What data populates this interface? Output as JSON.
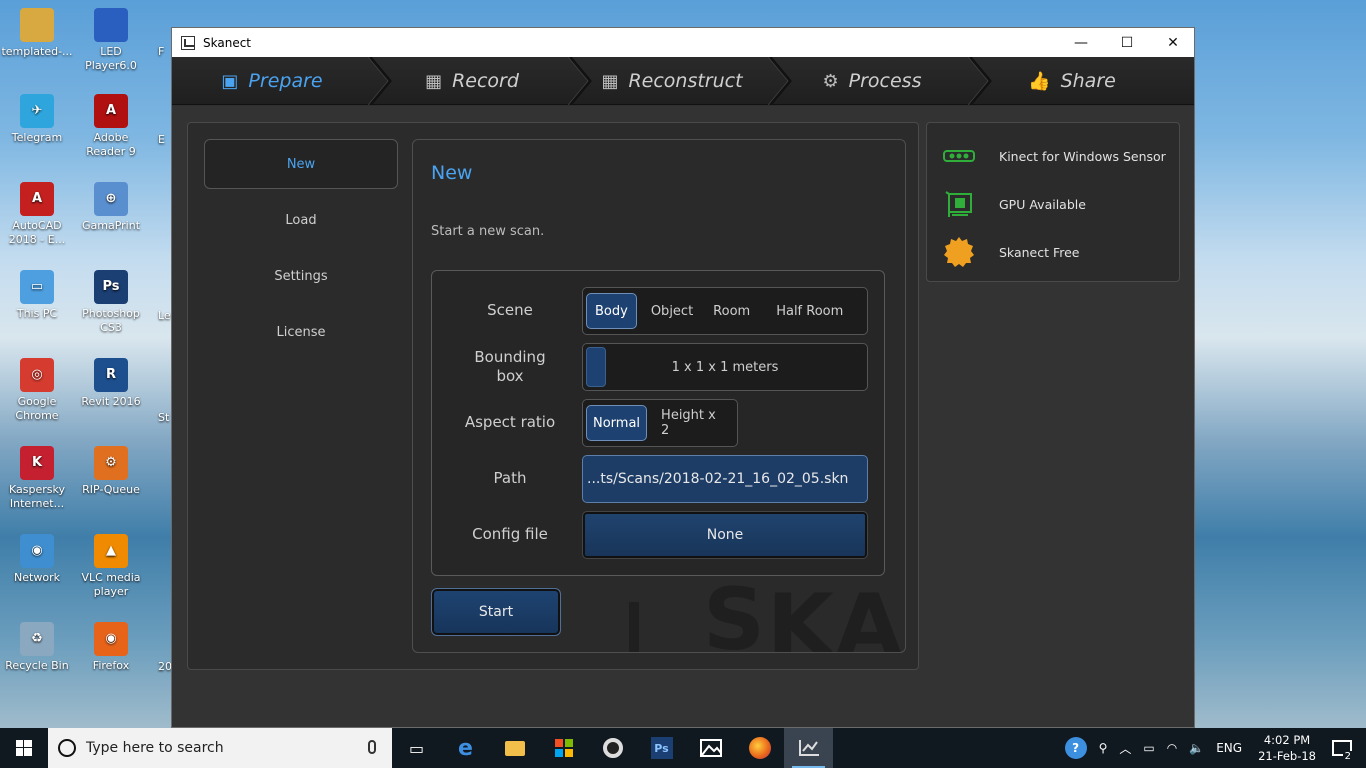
{
  "desktop": {
    "icons": [
      {
        "label": "templated-...",
        "color": "#d8a940",
        "glyph": ""
      },
      {
        "label": "LED Player6.0",
        "color": "#2b5fbf",
        "glyph": ""
      },
      {
        "label": "Telegram",
        "color": "#2ea6dd",
        "glyph": "✈"
      },
      {
        "label": "Adobe Reader 9",
        "color": "#b01010",
        "glyph": "A"
      },
      {
        "label": "AutoCAD 2018 - E...",
        "color": "#c42020",
        "glyph": "A"
      },
      {
        "label": "GamaPrint",
        "color": "#5a8fcf",
        "glyph": "⊕"
      },
      {
        "label": "This PC",
        "color": "#4d9fe0",
        "glyph": "▭"
      },
      {
        "label": "Photoshop CS3",
        "color": "#1b3e73",
        "glyph": "Ps"
      },
      {
        "label": "Google Chrome",
        "color": "#d53b2f",
        "glyph": "◎"
      },
      {
        "label": "Revit 2016",
        "color": "#1d4f8f",
        "glyph": "R"
      },
      {
        "label": "Kaspersky Internet...",
        "color": "#c42030",
        "glyph": "K"
      },
      {
        "label": "RIP-Queue",
        "color": "#e07020",
        "glyph": "⚙"
      },
      {
        "label": "Network",
        "color": "#3f8fd0",
        "glyph": "◉"
      },
      {
        "label": "VLC media player",
        "color": "#f08a00",
        "glyph": "▲"
      },
      {
        "label": "Recycle Bin",
        "color": "#8aa8c0",
        "glyph": "♻"
      },
      {
        "label": "Firefox",
        "color": "#e8631a",
        "glyph": "◉"
      }
    ],
    "peek_labels": [
      "F",
      "E",
      "Le",
      "St",
      "20"
    ]
  },
  "window": {
    "title": "Skanect",
    "minimize": "—",
    "maximize": "☐",
    "close": "✕"
  },
  "tabs": [
    {
      "label": "Prepare",
      "icon": "▣",
      "active": true
    },
    {
      "label": "Record",
      "icon": "▦",
      "active": false
    },
    {
      "label": "Reconstruct",
      "icon": "▦",
      "active": false
    },
    {
      "label": "Process",
      "icon": "⚙",
      "active": false
    },
    {
      "label": "Share",
      "icon": "👍",
      "active": false
    }
  ],
  "nav": {
    "new": "New",
    "load": "Load",
    "settings": "Settings",
    "license": "License"
  },
  "form": {
    "title": "New",
    "description": "Start a new scan.",
    "scene_label": "Scene",
    "scene_options": [
      "Body",
      "Object",
      "Room",
      "Half Room"
    ],
    "scene_selected": "Body",
    "bbox_label": "Bounding box",
    "bbox_value": "1 x 1 x 1 meters",
    "aspect_label": "Aspect ratio",
    "aspect_options": [
      "Normal",
      "Height x 2"
    ],
    "aspect_selected": "Normal",
    "path_label": "Path",
    "path_value": "...ts/Scans/2018-02-21_16_02_05.skn",
    "config_label": "Config file",
    "config_value": "None",
    "start_label": "Start",
    "watermark": "SKANECT"
  },
  "status": [
    {
      "label": "Kinect for Windows Sensor",
      "icon": "sensor-icon",
      "color": "#2fae3a"
    },
    {
      "label": "GPU Available",
      "icon": "gpu-icon",
      "color": "#2fae3a"
    },
    {
      "label": "Skanect Free",
      "icon": "seal-icon",
      "color": "#f0a020"
    }
  ],
  "taskbar": {
    "search_placeholder": "Type here to search",
    "language": "ENG",
    "time": "4:02 PM",
    "date": "21-Feb-18",
    "notifications": "2"
  }
}
